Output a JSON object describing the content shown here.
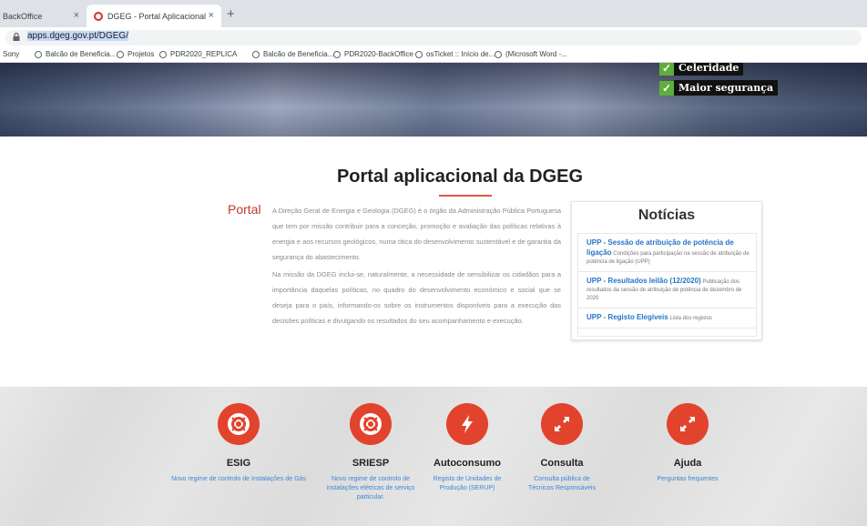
{
  "browser": {
    "tabs": [
      {
        "label": "BackOffice",
        "close": "×"
      },
      {
        "label": "DGEG - Portal Aplicacional",
        "close": "×"
      }
    ],
    "new_tab": "+",
    "url": "apps.dgeg.gov.pt/DGEG/",
    "bookmarks": [
      "Sony",
      "Balcão de Beneficia...",
      "Projetos",
      "PDR2020_REPLICA",
      "Balcão de Beneficia...",
      "PDR2020-BackOffice",
      "osTicket :: Início de...",
      "(Microsoft Word -..."
    ]
  },
  "hero": {
    "checks": [
      "Celeridade",
      "Maior segurança"
    ]
  },
  "main": {
    "title": "Portal aplicacional da DGEG",
    "section_label": "Portal",
    "paragraphs": [
      "A Direção Geral de Energia e Geologia (DGEG) é o órgão da Administração Pública Portuguesa que tem por missão contribuir para a conceção, promoção e avaliação das políticas relativas à energia e aos recursos geológicos, numa ótica do desenvolvimento sustentável e de garantia da segurança do abastecimento.",
      "Na missão da DGEG inclui-se, naturalmente, a necessidade de sensibilizar os cidadãos para a importância daquelas políticas, no quadro do desenvolvimento económico e social que se deseja para o país, informando-os sobre os instrumentos disponíveis para a execução das decisões políticas e divulgando os resultados do seu acompanhamento e execução."
    ]
  },
  "news": {
    "title": "Notícias",
    "items": [
      {
        "headline": "UPP - Sessão de atribuição de potência de ligação",
        "text": "Condições para participação na sessão de atribuição de potência de ligação (UPP)"
      },
      {
        "headline": "UPP - Resultados leilão (12/2020)",
        "text": "Publicação dos resultados da sessão de atribuição de potência de dezembro de 2020"
      },
      {
        "headline": "UPP - Registo Elegíveis",
        "text": "Lista dos registos"
      }
    ]
  },
  "services": [
    {
      "name": "ESIG",
      "desc": "Novo regime de controlo de Instalações de Gás",
      "icon": "lifebuoy-icon"
    },
    {
      "name": "SRIESP",
      "desc": "Novo regime de controlo de instalações elétricas de serviço particular.",
      "icon": "lifebuoy-icon"
    },
    {
      "name": "Autoconsumo",
      "desc": "Registo de Unidades de Produção (SERUP)",
      "icon": "lightning-icon"
    },
    {
      "name": "Consulta",
      "desc": "Consulta pública de Técnicos Responsáveis",
      "icon": "expand-arrows-icon"
    },
    {
      "name": "Ajuda",
      "desc": "Perguntas frequentes",
      "icon": "expand-arrows-icon"
    }
  ],
  "colors": {
    "accent_red": "#e2432d",
    "link_blue": "#3a87d6",
    "check_green": "#5fae3a"
  }
}
